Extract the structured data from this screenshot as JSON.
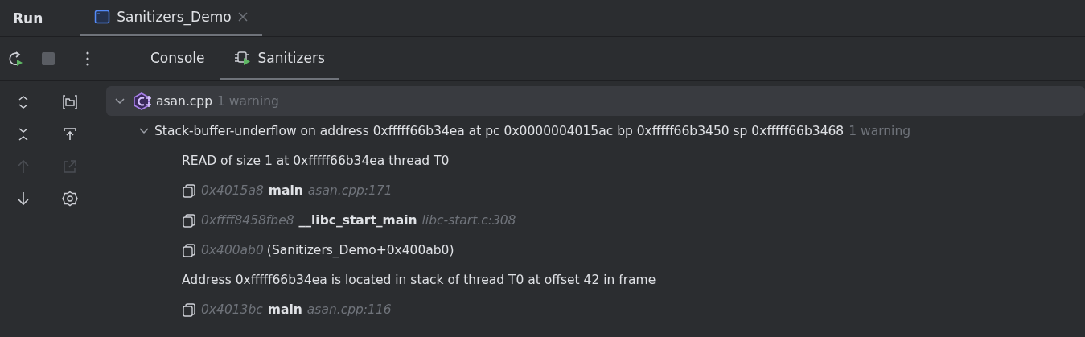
{
  "header": {
    "title": "Run",
    "tabs": [
      {
        "label": "Sanitizers_Demo",
        "selected": true,
        "closable": true
      }
    ]
  },
  "toolbar": {
    "buttons": [
      {
        "kind": "rerun"
      },
      {
        "kind": "stop"
      },
      {
        "kind": "more"
      }
    ],
    "tabs": [
      {
        "label": "Console",
        "selected": false,
        "kind": "console"
      },
      {
        "label": "Sanitizers",
        "selected": true,
        "kind": "sanitizers"
      }
    ]
  },
  "side_tools": [
    {
      "kind": "expand-all",
      "disabled": false
    },
    {
      "kind": "folder",
      "disabled": false
    },
    {
      "kind": "collapse-all",
      "disabled": false
    },
    {
      "kind": "upload",
      "disabled": false
    },
    {
      "kind": "up",
      "disabled": true
    },
    {
      "kind": "export",
      "disabled": true
    },
    {
      "kind": "down",
      "disabled": false
    },
    {
      "kind": "settings",
      "disabled": false
    }
  ],
  "tree": [
    {
      "kind": "file",
      "label": "asan.cpp",
      "count": "1 warning",
      "expanded": true,
      "selected": true,
      "children": [
        {
          "kind": "error",
          "label": "Stack-buffer-underflow on address 0xfffff66b34ea at pc 0x0000004015ac bp 0xfffff66b3450 sp 0xfffff66b3468",
          "count": "1 warning",
          "expanded": true,
          "selected": false,
          "children": [
            {
              "kind": "text",
              "label": "READ of size 1 at 0xfffff66b34ea thread T0"
            },
            {
              "kind": "frame",
              "address": "0x4015a8",
              "function": "main",
              "location": "asan.cpp:171"
            },
            {
              "kind": "frame",
              "address": "0xffff8458fbe8",
              "function": "__libc_start_main",
              "location": "libc-start.c:308"
            },
            {
              "kind": "frame",
              "address": "0x400ab0",
              "detail": "(Sanitizers_Demo+0x400ab0)"
            },
            {
              "kind": "text",
              "label": "Address 0xfffff66b34ea is located in stack of thread T0 at offset 42 in frame"
            },
            {
              "kind": "frame",
              "address": "0x4013bc",
              "function": "main",
              "location": "asan.cpp:116"
            }
          ]
        }
      ]
    }
  ]
}
